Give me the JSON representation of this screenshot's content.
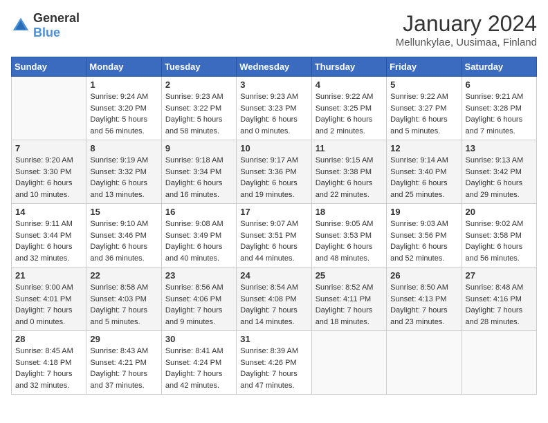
{
  "logo": {
    "general": "General",
    "blue": "Blue"
  },
  "header": {
    "month": "January 2024",
    "location": "Mellunkylae, Uusimaa, Finland"
  },
  "weekdays": [
    "Sunday",
    "Monday",
    "Tuesday",
    "Wednesday",
    "Thursday",
    "Friday",
    "Saturday"
  ],
  "weeks": [
    [
      {
        "day": "",
        "empty": true
      },
      {
        "day": "1",
        "sunrise": "Sunrise: 9:24 AM",
        "sunset": "Sunset: 3:20 PM",
        "daylight": "Daylight: 5 hours and 56 minutes."
      },
      {
        "day": "2",
        "sunrise": "Sunrise: 9:23 AM",
        "sunset": "Sunset: 3:22 PM",
        "daylight": "Daylight: 5 hours and 58 minutes."
      },
      {
        "day": "3",
        "sunrise": "Sunrise: 9:23 AM",
        "sunset": "Sunset: 3:23 PM",
        "daylight": "Daylight: 6 hours and 0 minutes."
      },
      {
        "day": "4",
        "sunrise": "Sunrise: 9:22 AM",
        "sunset": "Sunset: 3:25 PM",
        "daylight": "Daylight: 6 hours and 2 minutes."
      },
      {
        "day": "5",
        "sunrise": "Sunrise: 9:22 AM",
        "sunset": "Sunset: 3:27 PM",
        "daylight": "Daylight: 6 hours and 5 minutes."
      },
      {
        "day": "6",
        "sunrise": "Sunrise: 9:21 AM",
        "sunset": "Sunset: 3:28 PM",
        "daylight": "Daylight: 6 hours and 7 minutes."
      }
    ],
    [
      {
        "day": "7",
        "sunrise": "Sunrise: 9:20 AM",
        "sunset": "Sunset: 3:30 PM",
        "daylight": "Daylight: 6 hours and 10 minutes."
      },
      {
        "day": "8",
        "sunrise": "Sunrise: 9:19 AM",
        "sunset": "Sunset: 3:32 PM",
        "daylight": "Daylight: 6 hours and 13 minutes."
      },
      {
        "day": "9",
        "sunrise": "Sunrise: 9:18 AM",
        "sunset": "Sunset: 3:34 PM",
        "daylight": "Daylight: 6 hours and 16 minutes."
      },
      {
        "day": "10",
        "sunrise": "Sunrise: 9:17 AM",
        "sunset": "Sunset: 3:36 PM",
        "daylight": "Daylight: 6 hours and 19 minutes."
      },
      {
        "day": "11",
        "sunrise": "Sunrise: 9:15 AM",
        "sunset": "Sunset: 3:38 PM",
        "daylight": "Daylight: 6 hours and 22 minutes."
      },
      {
        "day": "12",
        "sunrise": "Sunrise: 9:14 AM",
        "sunset": "Sunset: 3:40 PM",
        "daylight": "Daylight: 6 hours and 25 minutes."
      },
      {
        "day": "13",
        "sunrise": "Sunrise: 9:13 AM",
        "sunset": "Sunset: 3:42 PM",
        "daylight": "Daylight: 6 hours and 29 minutes."
      }
    ],
    [
      {
        "day": "14",
        "sunrise": "Sunrise: 9:11 AM",
        "sunset": "Sunset: 3:44 PM",
        "daylight": "Daylight: 6 hours and 32 minutes."
      },
      {
        "day": "15",
        "sunrise": "Sunrise: 9:10 AM",
        "sunset": "Sunset: 3:46 PM",
        "daylight": "Daylight: 6 hours and 36 minutes."
      },
      {
        "day": "16",
        "sunrise": "Sunrise: 9:08 AM",
        "sunset": "Sunset: 3:49 PM",
        "daylight": "Daylight: 6 hours and 40 minutes."
      },
      {
        "day": "17",
        "sunrise": "Sunrise: 9:07 AM",
        "sunset": "Sunset: 3:51 PM",
        "daylight": "Daylight: 6 hours and 44 minutes."
      },
      {
        "day": "18",
        "sunrise": "Sunrise: 9:05 AM",
        "sunset": "Sunset: 3:53 PM",
        "daylight": "Daylight: 6 hours and 48 minutes."
      },
      {
        "day": "19",
        "sunrise": "Sunrise: 9:03 AM",
        "sunset": "Sunset: 3:56 PM",
        "daylight": "Daylight: 6 hours and 52 minutes."
      },
      {
        "day": "20",
        "sunrise": "Sunrise: 9:02 AM",
        "sunset": "Sunset: 3:58 PM",
        "daylight": "Daylight: 6 hours and 56 minutes."
      }
    ],
    [
      {
        "day": "21",
        "sunrise": "Sunrise: 9:00 AM",
        "sunset": "Sunset: 4:01 PM",
        "daylight": "Daylight: 7 hours and 0 minutes."
      },
      {
        "day": "22",
        "sunrise": "Sunrise: 8:58 AM",
        "sunset": "Sunset: 4:03 PM",
        "daylight": "Daylight: 7 hours and 5 minutes."
      },
      {
        "day": "23",
        "sunrise": "Sunrise: 8:56 AM",
        "sunset": "Sunset: 4:06 PM",
        "daylight": "Daylight: 7 hours and 9 minutes."
      },
      {
        "day": "24",
        "sunrise": "Sunrise: 8:54 AM",
        "sunset": "Sunset: 4:08 PM",
        "daylight": "Daylight: 7 hours and 14 minutes."
      },
      {
        "day": "25",
        "sunrise": "Sunrise: 8:52 AM",
        "sunset": "Sunset: 4:11 PM",
        "daylight": "Daylight: 7 hours and 18 minutes."
      },
      {
        "day": "26",
        "sunrise": "Sunrise: 8:50 AM",
        "sunset": "Sunset: 4:13 PM",
        "daylight": "Daylight: 7 hours and 23 minutes."
      },
      {
        "day": "27",
        "sunrise": "Sunrise: 8:48 AM",
        "sunset": "Sunset: 4:16 PM",
        "daylight": "Daylight: 7 hours and 28 minutes."
      }
    ],
    [
      {
        "day": "28",
        "sunrise": "Sunrise: 8:45 AM",
        "sunset": "Sunset: 4:18 PM",
        "daylight": "Daylight: 7 hours and 32 minutes."
      },
      {
        "day": "29",
        "sunrise": "Sunrise: 8:43 AM",
        "sunset": "Sunset: 4:21 PM",
        "daylight": "Daylight: 7 hours and 37 minutes."
      },
      {
        "day": "30",
        "sunrise": "Sunrise: 8:41 AM",
        "sunset": "Sunset: 4:24 PM",
        "daylight": "Daylight: 7 hours and 42 minutes."
      },
      {
        "day": "31",
        "sunrise": "Sunrise: 8:39 AM",
        "sunset": "Sunset: 4:26 PM",
        "daylight": "Daylight: 7 hours and 47 minutes."
      },
      {
        "day": "",
        "empty": true
      },
      {
        "day": "",
        "empty": true
      },
      {
        "day": "",
        "empty": true
      }
    ]
  ]
}
